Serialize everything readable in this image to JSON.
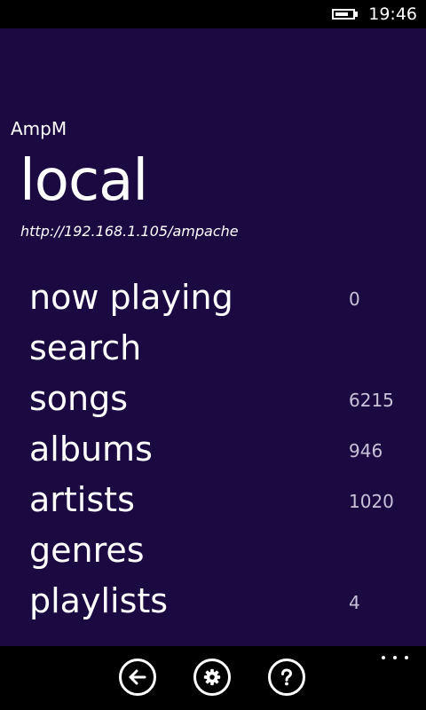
{
  "status_bar": {
    "time": "19:46",
    "battery_icon": "battery-icon"
  },
  "header": {
    "app_title": "AmpM",
    "page_title": "local",
    "server_url": "http://192.168.1.105/ampache"
  },
  "menu": {
    "items": [
      {
        "label": "now playing",
        "count": "0"
      },
      {
        "label": "search",
        "count": ""
      },
      {
        "label": "songs",
        "count": "6215"
      },
      {
        "label": "albums",
        "count": "946"
      },
      {
        "label": "artists",
        "count": "1020"
      },
      {
        "label": "genres",
        "count": ""
      },
      {
        "label": "playlists",
        "count": "4"
      }
    ]
  },
  "app_bar": {
    "buttons": [
      {
        "icon": "back-arrow-icon"
      },
      {
        "icon": "settings-gear-icon"
      },
      {
        "icon": "help-question-icon"
      }
    ],
    "more_icon": "more-ellipsis-icon"
  },
  "colors": {
    "panel_background": "#1b0a42",
    "chrome_background": "#000000",
    "text": "#ffffff",
    "count_text": "#c8c2d8"
  }
}
